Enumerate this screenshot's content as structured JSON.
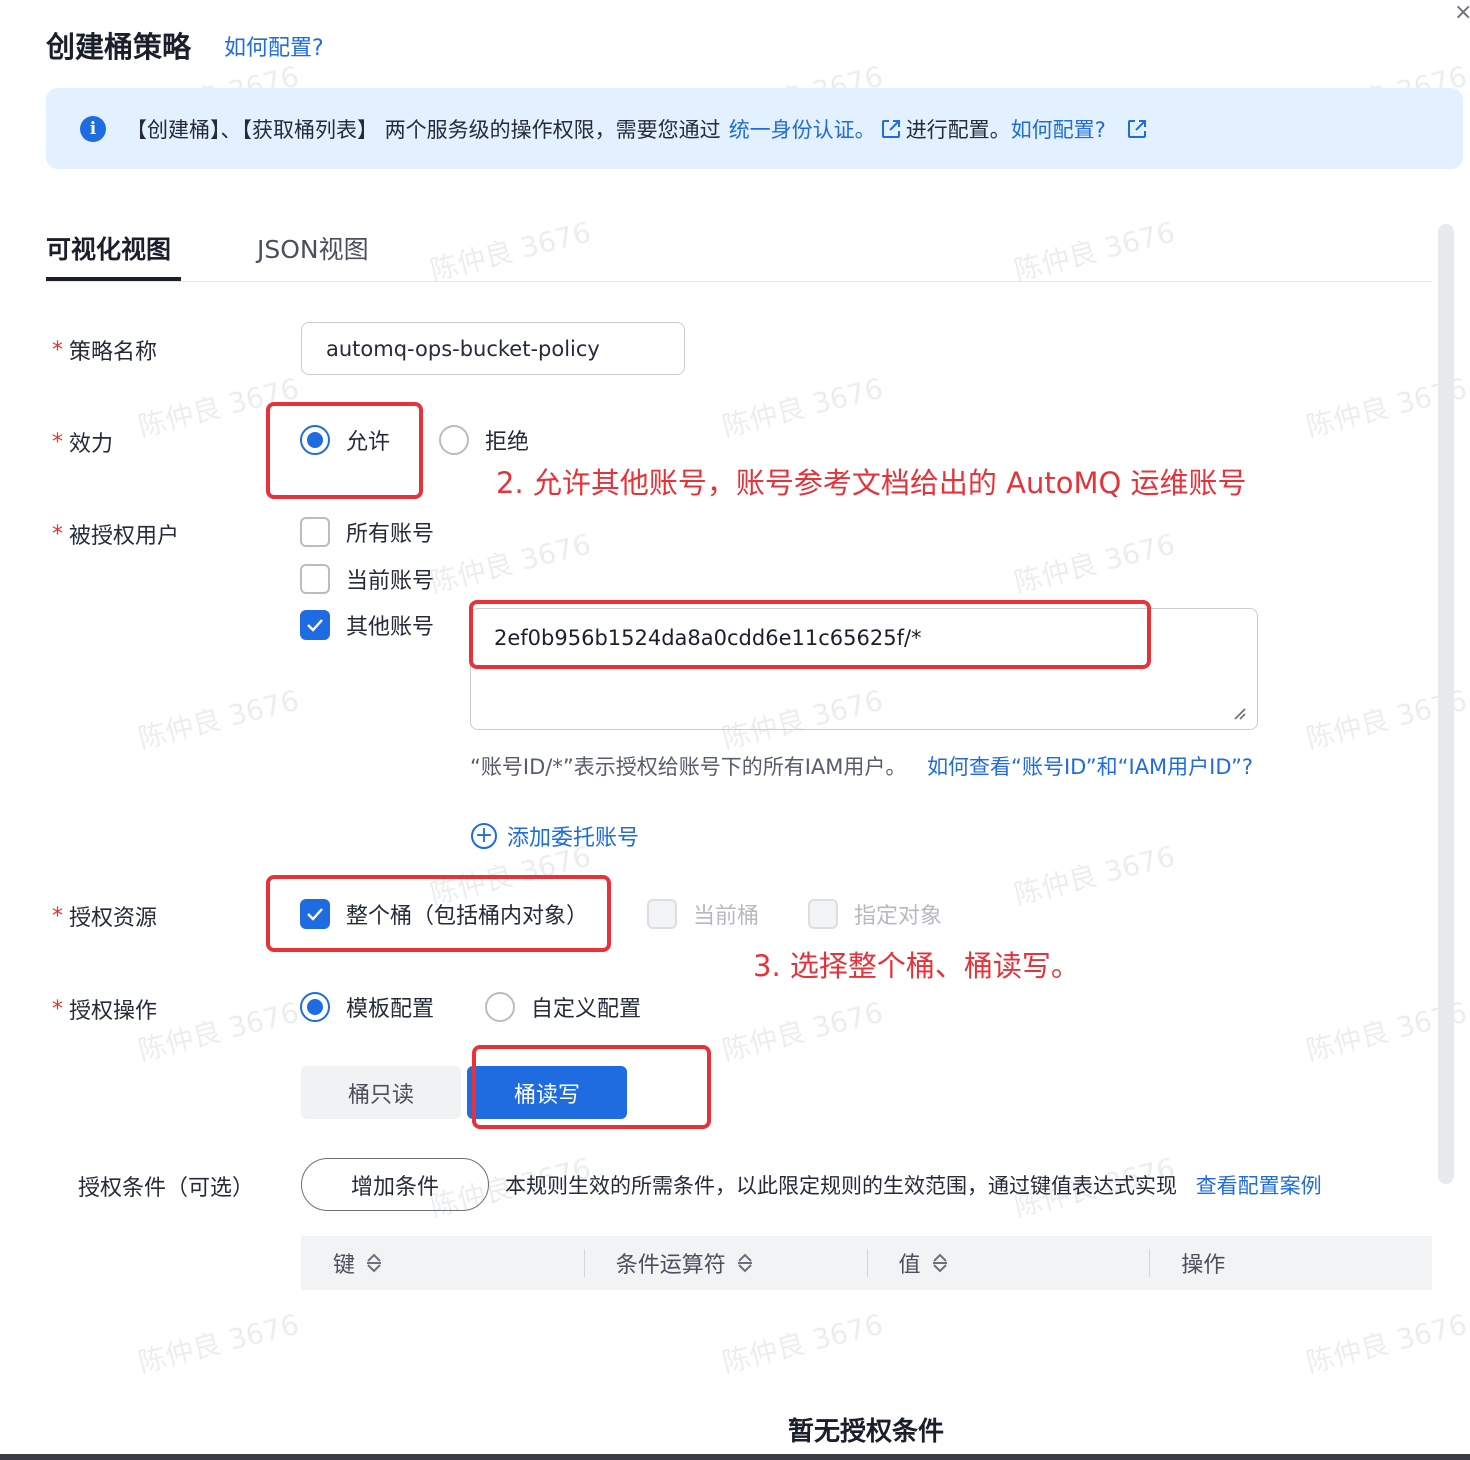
{
  "header": {
    "title": "创建桶策略",
    "help_link": "如何配置?",
    "close_label": "×"
  },
  "banner": {
    "info_glyph": "i",
    "text_pre": "【创建桶】、【获取桶列表】 两个服务级的操作权限，需要您通过",
    "iam_link": "统一身份认证。",
    "text_mid": "进行配置。",
    "help_link": "如何配置?"
  },
  "tabs": [
    {
      "label": "可视化视图",
      "active": true
    },
    {
      "label": "JSON视图",
      "active": false
    }
  ],
  "form": {
    "required_mark": "*",
    "policy_name": {
      "label": "策略名称",
      "value": "automq-ops-bucket-policy"
    },
    "effect": {
      "label": "效力",
      "options": [
        {
          "label": "允许",
          "checked": true
        },
        {
          "label": "拒绝",
          "checked": false
        }
      ]
    },
    "principal": {
      "label": "被授权用户",
      "options": [
        {
          "label": "所有账号",
          "checked": false
        },
        {
          "label": "当前账号",
          "checked": false
        },
        {
          "label": "其他账号",
          "checked": true
        }
      ],
      "account_value": "2ef0b956b1524da8a0cdd6e11c65625f/*",
      "hint": "“账号ID/*”表示授权给账号下的所有IAM用户。",
      "hint_link": "如何查看“账号ID”和“IAM用户ID”?",
      "add_account": "添加委托账号",
      "plus_glyph": "+"
    },
    "resource": {
      "label": "授权资源",
      "options": [
        {
          "label": "整个桶（包括桶内对象）",
          "checked": true,
          "disabled": false
        },
        {
          "label": "当前桶",
          "checked": false,
          "disabled": true
        },
        {
          "label": "指定对象",
          "checked": false,
          "disabled": true
        }
      ]
    },
    "action": {
      "label": "授权操作",
      "options": [
        {
          "label": "模板配置",
          "checked": true
        },
        {
          "label": "自定义配置",
          "checked": false
        }
      ],
      "templates": [
        {
          "label": "桶只读",
          "selected": false
        },
        {
          "label": "桶读写",
          "selected": true
        }
      ]
    },
    "condition": {
      "label": "授权条件（可选）",
      "add_button": "增加条件",
      "description": "本规则生效的所需条件，以此限定规则的生效范围，通过键值表达式实现",
      "example_link": "查看配置案例",
      "columns": [
        "键",
        "条件运算符",
        "值",
        "操作"
      ],
      "empty_text": "暂无授权条件"
    }
  },
  "annotations": {
    "step2": "2. 允许其他账号，账号参考文档给出的 AutoMQ 运维账号",
    "step3": "3. 选择整个桶、桶读写。"
  },
  "watermark": "陈仲良 3676",
  "colors": {
    "primary": "#1f6ce0",
    "annotation": "#e8323a",
    "required": "#e5332e",
    "banner_bg": "#e3f0ff"
  }
}
